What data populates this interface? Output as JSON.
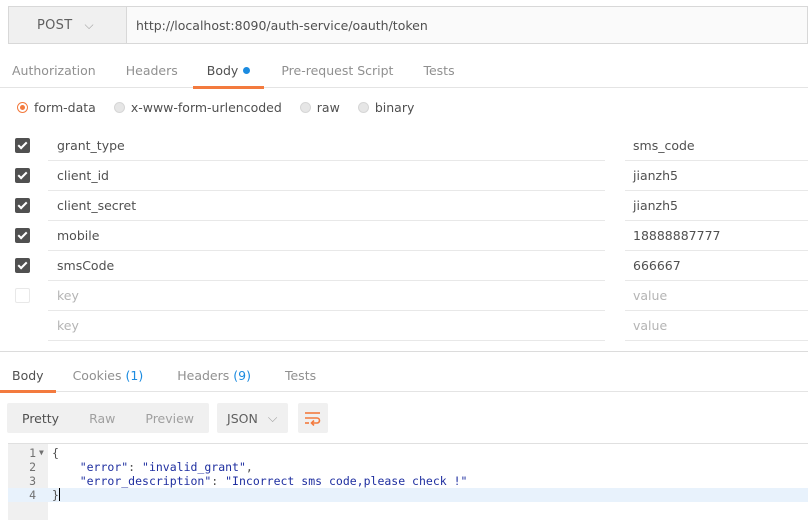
{
  "request": {
    "method": "POST",
    "url": "http://localhost:8090/auth-service/oauth/token"
  },
  "request_tabs": [
    "Authorization",
    "Headers",
    "Body",
    "Pre-request Script",
    "Tests"
  ],
  "body_types": [
    "form-data",
    "x-www-form-urlencoded",
    "raw",
    "binary"
  ],
  "params": [
    {
      "key": "grant_type",
      "value": "sms_code"
    },
    {
      "key": "client_id",
      "value": "jianzh5"
    },
    {
      "key": "client_secret",
      "value": "jianzh5"
    },
    {
      "key": "mobile",
      "value": "18888887777"
    },
    {
      "key": "smsCode",
      "value": "666667"
    },
    {
      "key": "key",
      "value": "value"
    },
    {
      "key": "key",
      "value": "value"
    }
  ],
  "response_tabs": {
    "body": "Body",
    "cookies": "Cookies",
    "cookies_count": "(1)",
    "headers": "Headers",
    "headers_count": "(9)",
    "tests": "Tests"
  },
  "view_modes": [
    "Pretty",
    "Raw",
    "Preview"
  ],
  "format": "JSON",
  "code": {
    "line_numbers": [
      "1",
      "2",
      "3",
      "4"
    ],
    "open": "{",
    "error_key": "\"error\"",
    "error_value": "\"invalid_grant\"",
    "desc_key": "\"error_description\"",
    "desc_value": "\"Incorrect sms code,please check !\"",
    "close": "}"
  },
  "colors": {
    "accent": "#f37a3e",
    "link_blue": "#1b8be0"
  }
}
